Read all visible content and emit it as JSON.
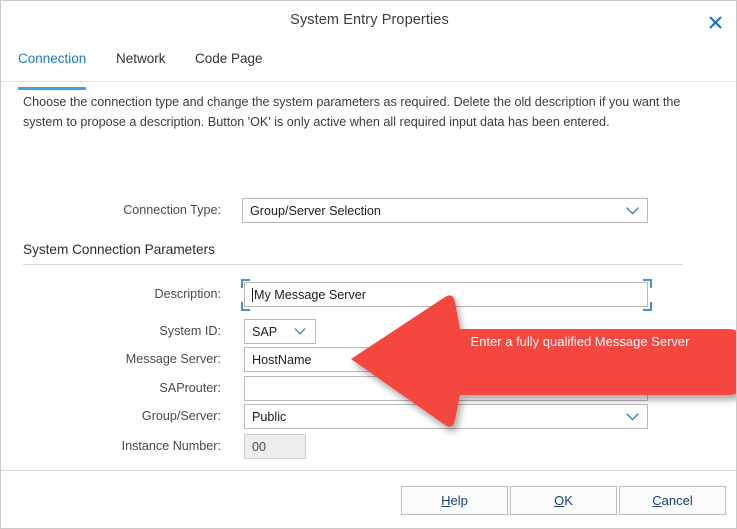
{
  "window": {
    "title": "System Entry Properties",
    "close_icon": "close-icon",
    "close_glyph": "✕"
  },
  "tabs": [
    {
      "label": "Connection",
      "active": true
    },
    {
      "label": "Network",
      "active": false
    },
    {
      "label": "Code Page",
      "active": false
    }
  ],
  "intro": "Choose the connection type and change the system parameters as required. Delete the old description if you want the system to propose a description. Button 'OK' is only active when all required input data has been entered.",
  "connection_type": {
    "label": "Connection Type:",
    "value": "Group/Server Selection",
    "icon": "chevron-down-icon"
  },
  "section": {
    "title": "System Connection Parameters"
  },
  "fields": {
    "description": {
      "label": "Description:",
      "value": "My Message Server",
      "focused": true
    },
    "system_id": {
      "label": "System ID:",
      "value": "SAP",
      "icon": "chevron-down-icon"
    },
    "message_server": {
      "label": "Message Server:",
      "value": "HostName"
    },
    "saprouter": {
      "label": "SAProuter:",
      "value": ""
    },
    "group_server": {
      "label": "Group/Server:",
      "value": "Public",
      "icon": "chevron-down-icon"
    },
    "instance_number": {
      "label": "Instance Number:",
      "value": "00",
      "disabled": true
    }
  },
  "annotation": {
    "text": "Enter a fully qualified Message Server",
    "color": "#F4473F",
    "shape": "left-arrow"
  },
  "buttons": {
    "help": {
      "prefix": "",
      "accel": "H",
      "suffix": "elp"
    },
    "ok": {
      "prefix": "",
      "accel": "O",
      "suffix": "K"
    },
    "cancel": {
      "prefix": "",
      "accel": "C",
      "suffix": "ancel"
    }
  },
  "colors": {
    "accent": "#41a4e0",
    "tab_active_text": "#1b7ac4",
    "button_text": "#17407c",
    "annotation_red": "#F4473F",
    "focus_marker": "#4a90d9"
  }
}
